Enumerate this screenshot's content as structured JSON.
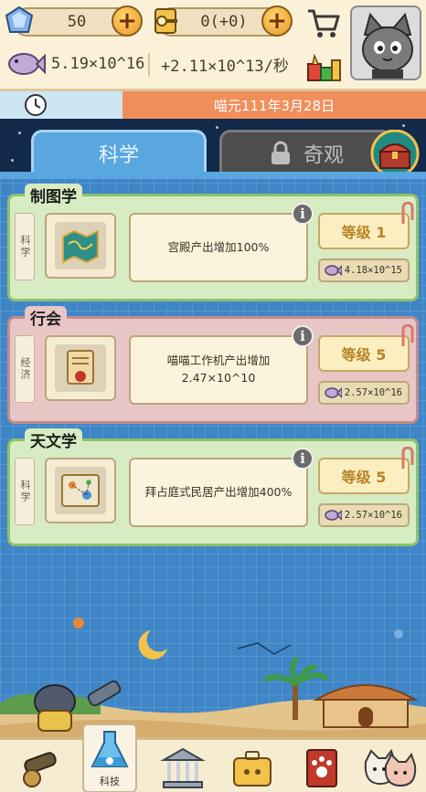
{
  "resources": {
    "gems": "50",
    "keys": "0(+0)",
    "cat_total": "5.19×10^16",
    "rate": "+2.11×10^13/秒"
  },
  "date": "喵元111年3月28日",
  "tabs": [
    {
      "label": "科学",
      "active": true
    },
    {
      "label": "奇观",
      "active": false,
      "locked": true
    }
  ],
  "cards": [
    {
      "category": "制图学",
      "side_label": "科学",
      "description": "宫殿产出增加100%",
      "level": "等级 1",
      "cost": "4.18×10^15",
      "theme": "green"
    },
    {
      "category": "行会",
      "side_label": "经济",
      "description": "喵喵工作机产出增加2.47×10^10",
      "level": "等级 5",
      "cost": "2.57×10^16",
      "theme": "red"
    },
    {
      "category": "天文学",
      "side_label": "科学",
      "description": "拜占庭式民居产出增加400%",
      "level": "等级 5",
      "cost": "2.57×10^16",
      "theme": "green"
    }
  ],
  "info_symbol": "i",
  "nav": [
    {
      "icon": "cannon-icon",
      "active": false
    },
    {
      "icon": "flask-icon",
      "label": "科技",
      "active": true
    },
    {
      "icon": "temple-icon",
      "active": false
    },
    {
      "icon": "cat-briefcase-icon",
      "active": false
    },
    {
      "icon": "paw-book-icon",
      "active": false
    },
    {
      "icon": "cat-faces-icon",
      "active": false
    }
  ],
  "colors": {
    "accent_orange": "#f08f5b",
    "tab_blue": "#5aa6e0",
    "card_green": "#d7ecc2",
    "card_red": "#e8c6c6",
    "gold": "#b78427"
  }
}
